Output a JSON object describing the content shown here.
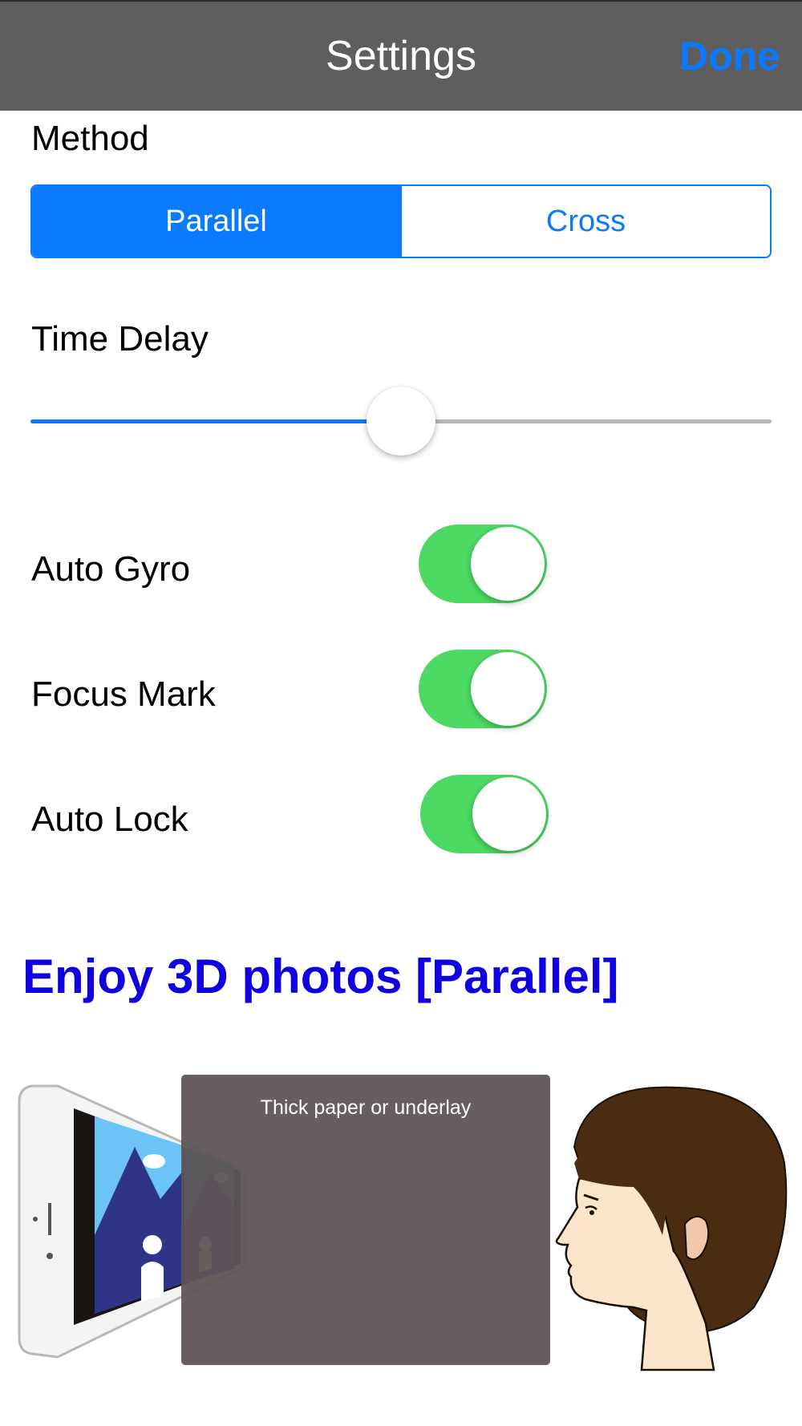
{
  "navbar": {
    "title": "Settings",
    "done_label": "Done"
  },
  "method": {
    "label": "Method",
    "options": [
      "Parallel",
      "Cross"
    ],
    "selected": "Parallel"
  },
  "time_delay": {
    "label": "Time Delay",
    "value_fraction": 0.5
  },
  "toggles": [
    {
      "label": "Auto Gyro",
      "on": true
    },
    {
      "label": "Focus Mark",
      "on": true
    },
    {
      "label": "Auto Lock",
      "on": true
    }
  ],
  "instructions": {
    "heading": "Enjoy 3D photos [Parallel]",
    "paper_label": "Thick paper or underlay"
  },
  "colors": {
    "accent": "#0a7bff",
    "toggle_on": "#4cd964",
    "navbar_bg": "#5e5e5e",
    "heading": "#1000e0"
  }
}
